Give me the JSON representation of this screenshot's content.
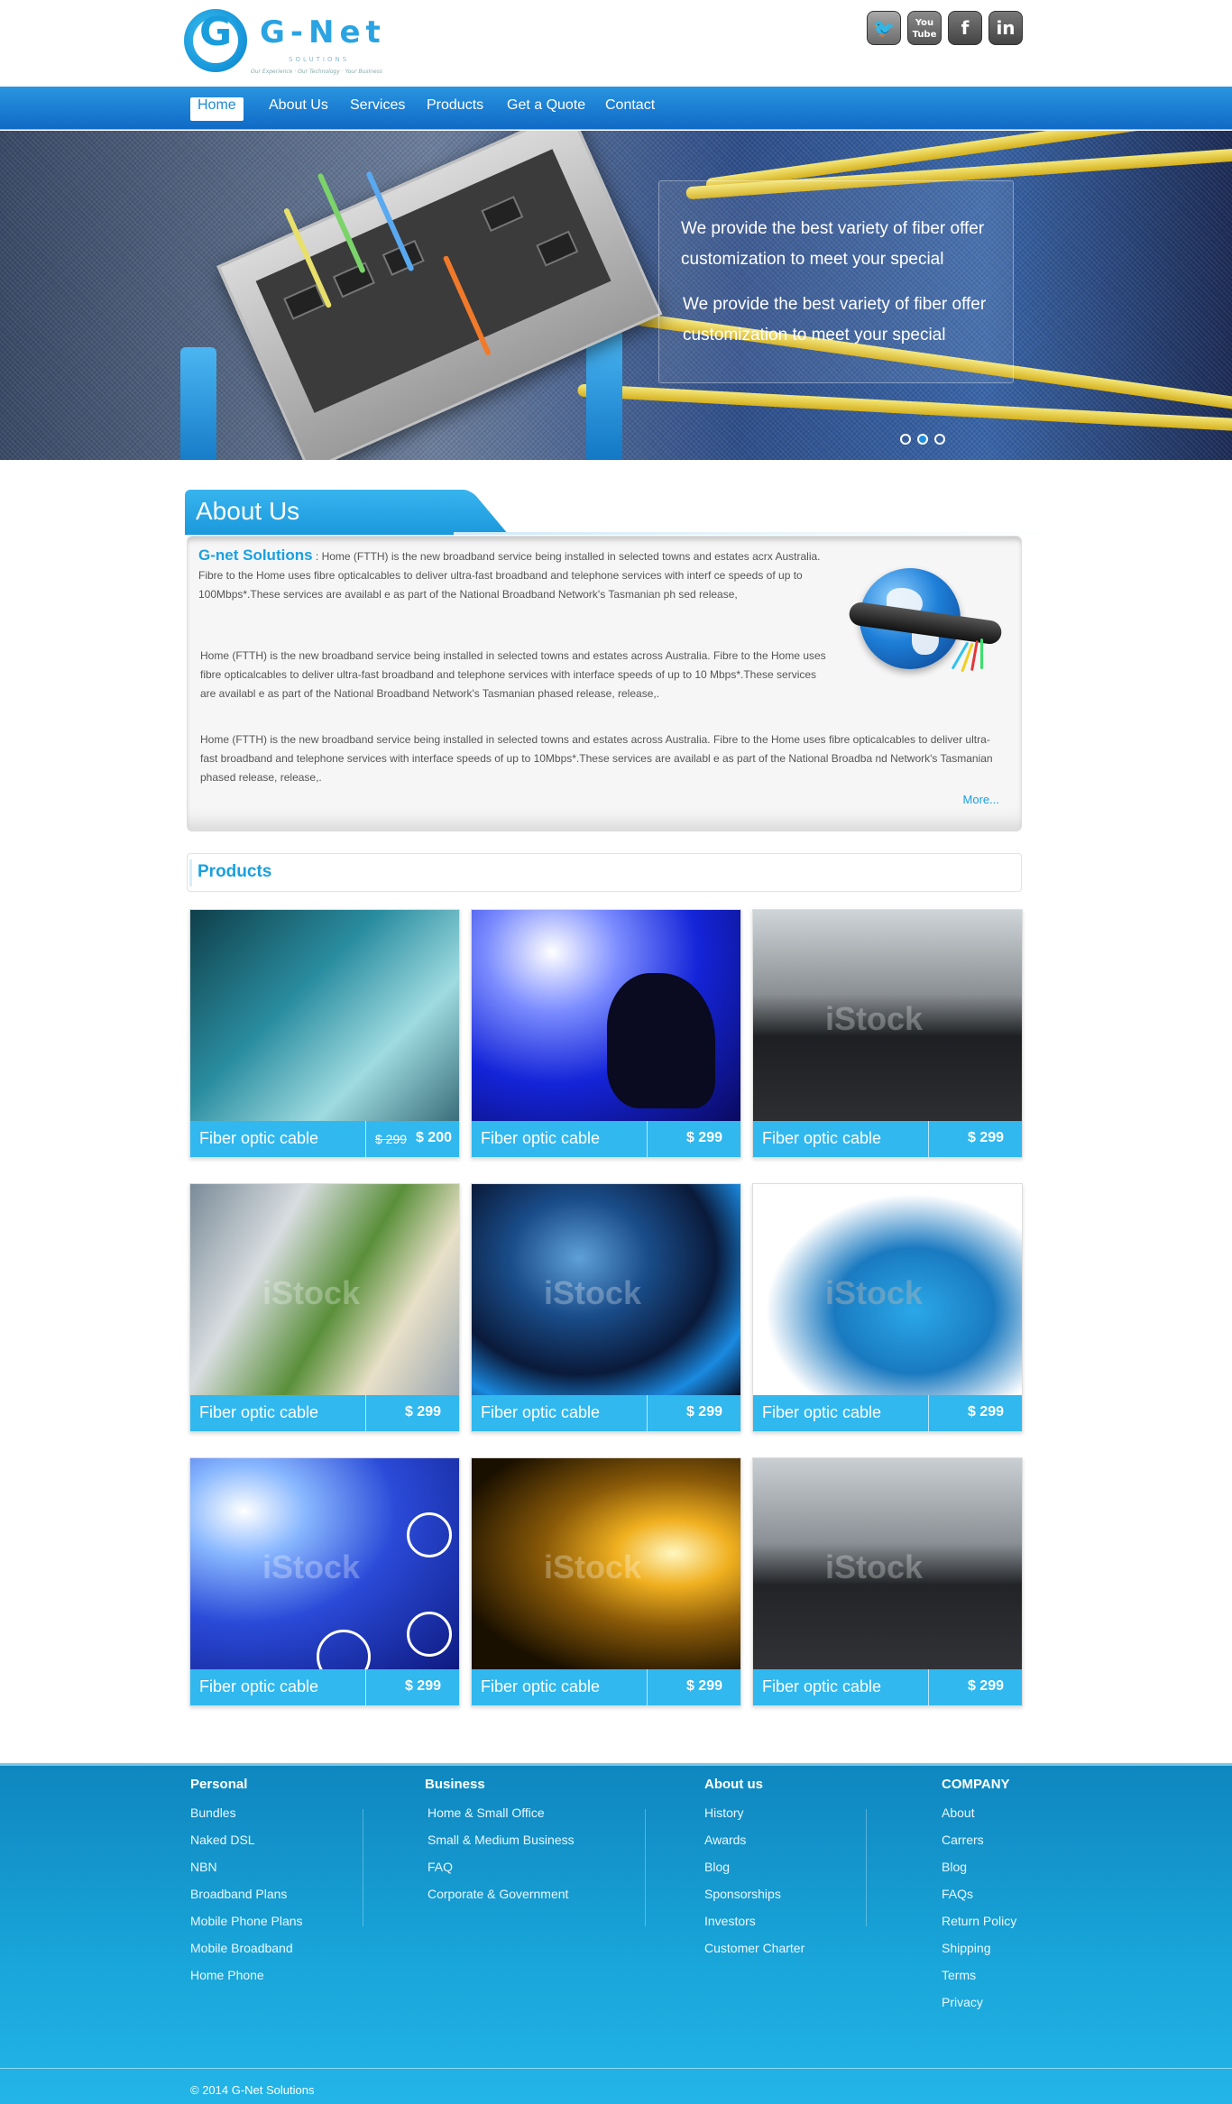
{
  "brand": {
    "name": "G-Net",
    "subtitle": "SOLUTIONS",
    "tagline": "Our Experience · Our Technology · Your Business",
    "logo_letter": "G"
  },
  "social": [
    {
      "name": "twitter-icon",
      "glyph": "🐦"
    },
    {
      "name": "youtube-icon",
      "glyph": "You Tube"
    },
    {
      "name": "facebook-icon",
      "glyph": "f"
    },
    {
      "name": "linkedin-icon",
      "glyph": "in"
    }
  ],
  "nav": {
    "items": [
      "Home",
      "About Us",
      "Services",
      "Products",
      "Get a Quote",
      "Contact"
    ],
    "active": "Home"
  },
  "banner": {
    "line1": "We provide the best variety of fiber  offer customization to meet your special",
    "line2": "We provide the best variety of fiber  offer customization to meet your special",
    "dots": 3,
    "active_dot": 2
  },
  "about": {
    "title": "About Us",
    "brand_label": "G-net Solutions",
    "lead": "Home (FTTH) is the new broadband service being installed in selected towns and estates acrx Australia. Fibre to the Home uses fibre opticalcables to deliver ultra-fast broadband and telephone services with interf ce speeds of up to 100Mbps*.These services are availabl e as part of the National Broadband Network's Tasmanian ph sed release,",
    "para2": "Home (FTTH) is the new broadband service being installed in selected towns and estates across Australia. Fibre to the Home uses fibre opticalcables to deliver ultra-fast broadband and telephone services with interface speeds of up to 10 Mbps*.These services are availabl e as part of the National Broadband Network's Tasmanian phased release,   release,.",
    "para3": "Home (FTTH) is the new broadband service being installed in selected towns and estates across Australia. Fibre to the Home uses fibre opticalcables to deliver ultra-fast broadband and telephone services with interface speeds of up to 10Mbps*.These services are availabl e as part of the National Broadba nd Network's Tasmanian phased release,   release,.",
    "more": "More..."
  },
  "products": {
    "title": "Products",
    "items": [
      {
        "name": "Fiber optic cable",
        "price": "$ 200",
        "old_price": "$ 299"
      },
      {
        "name": "Fiber optic cable",
        "price": "$ 299"
      },
      {
        "name": "Fiber optic cable",
        "price": "$ 299"
      },
      {
        "name": "Fiber optic cable",
        "price": "$ 299"
      },
      {
        "name": "Fiber optic cable",
        "price": "$ 299"
      },
      {
        "name": "Fiber optic cable",
        "price": "$ 299"
      },
      {
        "name": "Fiber optic cable",
        "price": "$ 299"
      },
      {
        "name": "Fiber optic cable",
        "price": "$ 299"
      },
      {
        "name": "Fiber optic cable",
        "price": "$ 299"
      }
    ],
    "watermark": "iStock"
  },
  "footer": {
    "columns": [
      {
        "title": "Personal",
        "links": [
          "Bundles",
          "Naked DSL",
          "NBN",
          "Broadband Plans",
          "Mobile Phone Plans",
          "Mobile Broadband",
          "Home Phone"
        ]
      },
      {
        "title": "Business",
        "links": [
          "Home & Small Office",
          "Small & Medium Business",
          "FAQ",
          "Corporate & Government"
        ]
      },
      {
        "title": "About us",
        "links": [
          "History",
          "Awards",
          "Blog",
          "Sponsorships",
          "Investors",
          "Customer Charter"
        ]
      },
      {
        "title": "COMPANY",
        "links": [
          "About",
          "Carrers",
          "Blog",
          "FAQs",
          "Return Policy",
          "Shipping",
          "Terms",
          "Privacy"
        ]
      }
    ],
    "copyright": "© 2014 G-Net Solutions"
  },
  "colors": {
    "accent": "#1aa0e0",
    "nav": "#1a7fd4",
    "card_bar": "#30b8ef",
    "footer": "#18a4d8"
  }
}
